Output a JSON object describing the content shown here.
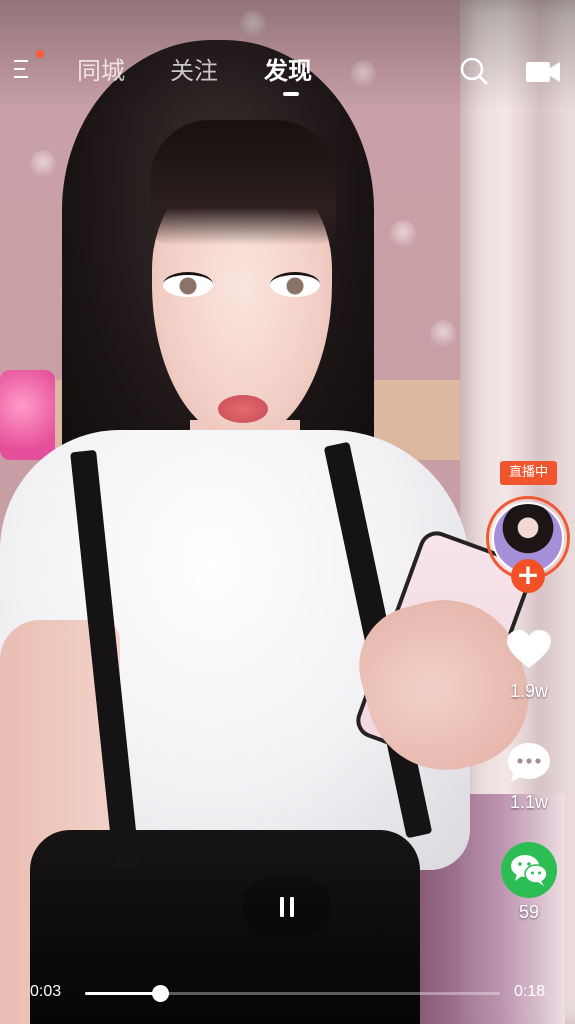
{
  "header": {
    "tabs": [
      {
        "label": "同城",
        "active": false
      },
      {
        "label": "关注",
        "active": false
      },
      {
        "label": "发现",
        "active": true
      }
    ],
    "menu_icon": "menu-icon",
    "notification_dot_color": "#ff5a3c",
    "search_icon": "search-icon",
    "camera_icon": "camera-icon"
  },
  "sidebar": {
    "live_badge": "直播中",
    "follow_label": "+",
    "likes": "1.9w",
    "comments": "1.1w",
    "shares": "59",
    "accent_color": "#f0552e",
    "share_color": "#2dbd55"
  },
  "player": {
    "elapsed": "0:03",
    "duration": "0:18",
    "progress": 0.18,
    "pause_icon": "pause-icon"
  }
}
